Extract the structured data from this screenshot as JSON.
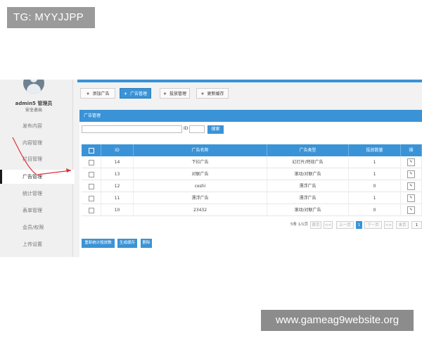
{
  "watermarks": {
    "top_left": "TG: MYYJJPP",
    "bottom_right": "www.gameag9website.org"
  },
  "sidebar": {
    "user_name": "admin5 管理员",
    "logout": "安全退出",
    "items": [
      {
        "label": "发布内容",
        "active": false
      },
      {
        "label": "内容管理",
        "active": false
      },
      {
        "label": "栏目管理",
        "active": false
      },
      {
        "label": "广告管理",
        "active": true
      },
      {
        "label": "统计管理",
        "active": false
      },
      {
        "label": "表单管理",
        "active": false
      },
      {
        "label": "会员/权限",
        "active": false
      },
      {
        "label": "上传设置",
        "active": false
      }
    ]
  },
  "toolbar": {
    "buttons": [
      {
        "label": "添加广告",
        "active": false
      },
      {
        "label": "广告管理",
        "active": true
      },
      {
        "label": "投放管理",
        "active": false
      },
      {
        "label": "更新缓存",
        "active": false
      }
    ]
  },
  "panel": {
    "title": "广告管理",
    "search": {
      "value": "",
      "id_label": "ID",
      "id_value": "",
      "button": "搜索"
    }
  },
  "table": {
    "columns": [
      "",
      "ID",
      "广告名称",
      "广告类型",
      "投放数量",
      "操"
    ],
    "rows": [
      {
        "id": "14",
        "name": "下拉广告",
        "type": "幻灯片/特效广告",
        "count": "1"
      },
      {
        "id": "13",
        "name": "对联广告",
        "type": "滚动/对联广告",
        "count": "1"
      },
      {
        "id": "12",
        "name": "ceshi",
        "type": "漂浮广告",
        "count": "0"
      },
      {
        "id": "11",
        "name": "漂浮广告",
        "type": "漂浮广告",
        "count": "1"
      },
      {
        "id": "10",
        "name": "23432",
        "type": "滚动/对联广告",
        "count": "0"
      }
    ]
  },
  "pager": {
    "summary": "5条 1/1页",
    "first": "首页",
    "prev_arrow": "<<",
    "prev": "上一页",
    "current": "1",
    "next": "下一页",
    "next_arrow": ">>",
    "last": "末页",
    "goto_value": "1"
  },
  "actions": {
    "buttons": [
      "重新统计投放数",
      "生成缓存",
      "删除"
    ]
  },
  "colors": {
    "accent": "#3a93d6",
    "arrow": "#e0303a"
  }
}
